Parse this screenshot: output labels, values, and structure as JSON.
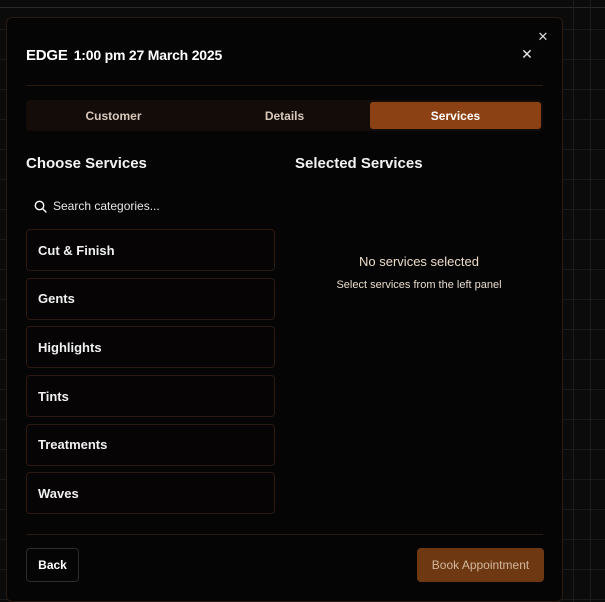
{
  "header": {
    "salon": "EDGE",
    "datetime": "1:00 pm 27 March 2025"
  },
  "tabs": [
    {
      "label": "Customer",
      "active": false
    },
    {
      "label": "Details",
      "active": false
    },
    {
      "label": "Services",
      "active": true
    }
  ],
  "choose": {
    "title": "Choose Services",
    "search_placeholder": "Search categories...",
    "categories": [
      "Cut & Finish",
      "Gents",
      "Highlights",
      "Tints",
      "Treatments",
      "Waves"
    ]
  },
  "selected": {
    "title": "Selected Services",
    "empty_title": "No services selected",
    "empty_sub": "Select services from the left panel"
  },
  "footer": {
    "back_label": "Back",
    "book_label": "Book Appointment"
  },
  "icons": {
    "close": "close-icon",
    "search": "search-icon"
  },
  "colors": {
    "accent": "#8c4114",
    "book_button": "#6e3812",
    "border": "#2c1a10"
  }
}
